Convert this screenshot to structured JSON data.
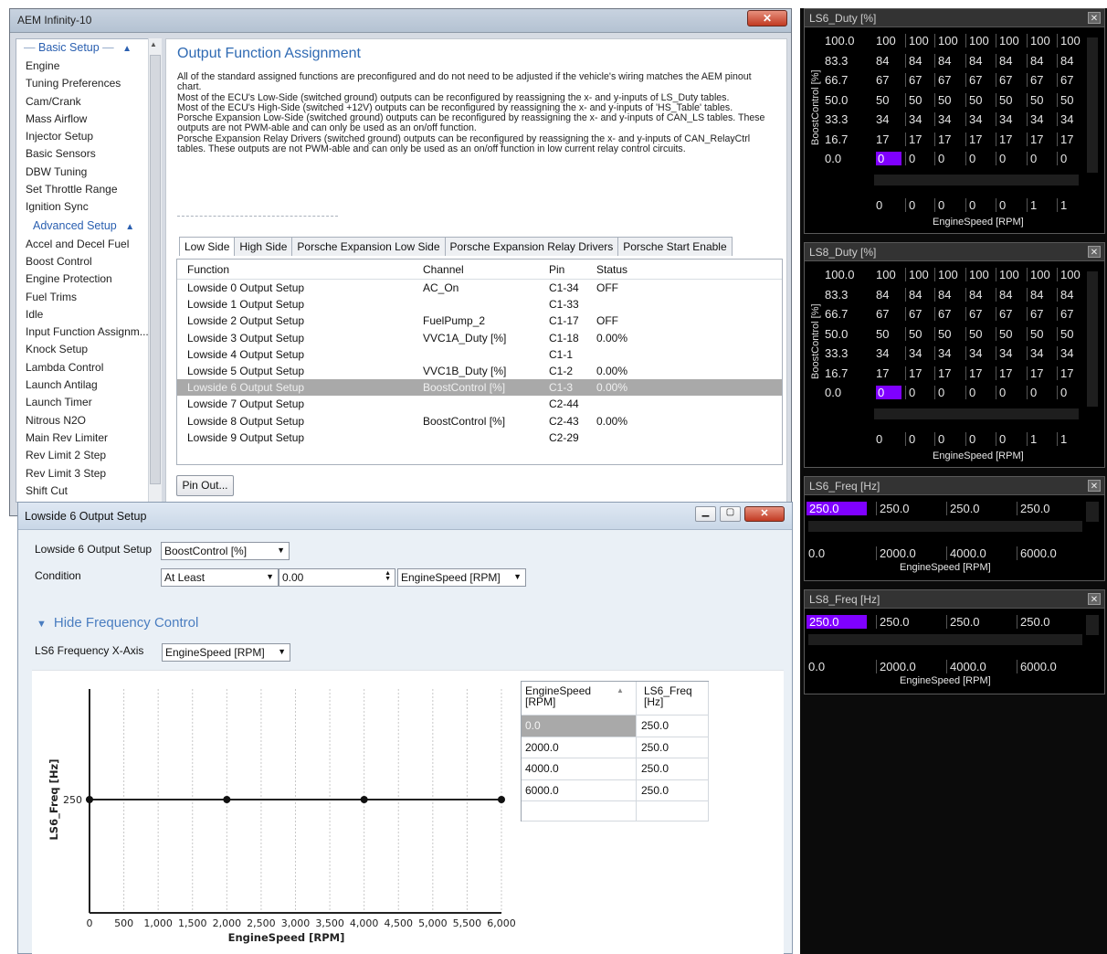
{
  "main_window": {
    "title": "AEM Infinity-10",
    "close_glyph": "✕"
  },
  "nav": {
    "basic_setup_header": "Basic Setup",
    "basic_items": [
      "Engine",
      "Tuning Preferences",
      "Cam/Crank",
      "Mass Airflow",
      "Injector Setup",
      "Basic Sensors",
      "DBW Tuning",
      "Set Throttle Range",
      "Ignition Sync"
    ],
    "advanced_setup_header": "Advanced Setup",
    "advanced_items": [
      "Accel and Decel Fuel",
      "Boost Control",
      "Engine Protection",
      "Fuel Trims",
      "Idle",
      "Input Function Assignm...",
      "Knock Setup",
      "Lambda Control",
      "Launch Antilag",
      "Launch Timer",
      "Nitrous N2O",
      "Main Rev Limiter",
      "Rev Limit 2 Step",
      "Rev Limit 3 Step",
      "Shift Cut"
    ]
  },
  "content": {
    "title": "Output Function Assignment",
    "paragraphs": [
      "All of the standard assigned functions are preconfigured and do not need to be adjusted if the vehicle's wiring matches the AEM pinout chart.",
      "Most of the ECU's Low-Side (switched ground) outputs can be reconfigured by reassigning the x- and y-inputs of LS_Duty tables.",
      "Most of the ECU's High-Side (switched +12V) outputs can be reconfigured by reassigning the x- and y-inputs of 'HS_Table' tables.",
      "Porsche Expansion Low-Side (switched ground) outputs can be reconfigured by reassigning the x- and y-inputs of CAN_LS tables. These outputs are not PWM-able and can only be used as an on/off function.",
      "Porsche Expansion Relay Drivers (switched ground) outputs can be reconfigured by reassigning the x- and y-inputs of CAN_RelayCtrl tables. These outputs are not PWM-able and can only be used as an on/off function in low current relay control circuits."
    ],
    "tabs": [
      "Low Side",
      "High Side",
      "Porsche Expansion Low Side",
      "Porsche Expansion Relay Drivers",
      "Porsche Start Enable"
    ],
    "table": {
      "headers": [
        "Function",
        "Channel",
        "Pin",
        "Status"
      ],
      "rows": [
        {
          "function": "Lowside 0 Output Setup",
          "channel": "AC_On",
          "pin": "C1-34",
          "status": "OFF"
        },
        {
          "function": "Lowside 1 Output Setup",
          "channel": "",
          "pin": "C1-33",
          "status": ""
        },
        {
          "function": "Lowside 2 Output Setup",
          "channel": "FuelPump_2",
          "pin": "C1-17",
          "status": "OFF"
        },
        {
          "function": "Lowside 3 Output Setup",
          "channel": "VVC1A_Duty [%]",
          "pin": "C1-18",
          "status": "0.00%"
        },
        {
          "function": "Lowside 4 Output Setup",
          "channel": "",
          "pin": "C1-1",
          "status": ""
        },
        {
          "function": "Lowside 5 Output Setup",
          "channel": "VVC1B_Duty [%]",
          "pin": "C1-2",
          "status": "0.00%"
        },
        {
          "function": "Lowside 6 Output Setup",
          "channel": "BoostControl [%]",
          "pin": "C1-3",
          "status": "0.00%"
        },
        {
          "function": "Lowside 7 Output Setup",
          "channel": "",
          "pin": "C2-44",
          "status": ""
        },
        {
          "function": "Lowside 8 Output Setup",
          "channel": "BoostControl [%]",
          "pin": "C2-43",
          "status": "0.00%"
        },
        {
          "function": "Lowside 9 Output Setup",
          "channel": "",
          "pin": "C2-29",
          "status": ""
        }
      ]
    },
    "pinout_button": "Pin Out..."
  },
  "sub_window": {
    "title": "Lowside 6 Output Setup",
    "setup_label": "Lowside 6 Output Setup",
    "setup_value": "BoostControl [%]",
    "condition_label": "Condition",
    "condition_value": "At Least",
    "condition_number": "0.00",
    "condition_channel": "EngineSpeed [RPM]",
    "freq_toggle": "Hide Frequency Control",
    "freq_xaxis_label": "LS6 Frequency X-Axis",
    "freq_xaxis_value": "EngineSpeed [RPM]",
    "freq_table": {
      "col1": "EngineSpeed [RPM]",
      "col2": "LS6_Freq [Hz]",
      "rows": [
        [
          "0.0",
          "250.0"
        ],
        [
          "2000.0",
          "250.0"
        ],
        [
          "4000.0",
          "250.0"
        ],
        [
          "6000.0",
          "250.0"
        ]
      ]
    }
  },
  "chart_data": {
    "type": "line",
    "x": [
      0,
      2000,
      4000,
      6000
    ],
    "y": [
      250,
      250,
      250,
      250
    ],
    "xlabel": "EngineSpeed [RPM]",
    "ylabel": "LS6_Freq [Hz]",
    "xlim": [
      0,
      6000
    ],
    "xticks": [
      "0",
      "500",
      "1,000",
      "1,500",
      "2,000",
      "2,500",
      "3,000",
      "3,500",
      "4,000",
      "4,500",
      "5,000",
      "5,500",
      "6,000"
    ],
    "yticks": [
      "250"
    ],
    "grid": "vertical"
  },
  "right_panel": {
    "ls6_duty": {
      "title": "LS6_Duty [%]",
      "ylabel": "BoostControl [%]",
      "rows": [
        [
          "100.0",
          "100",
          "100",
          "100",
          "100",
          "100",
          "100",
          "100"
        ],
        [
          "83.3",
          "84",
          "84",
          "84",
          "84",
          "84",
          "84",
          "84"
        ],
        [
          "66.7",
          "67",
          "67",
          "67",
          "67",
          "67",
          "67",
          "67"
        ],
        [
          "50.0",
          "50",
          "50",
          "50",
          "50",
          "50",
          "50",
          "50"
        ],
        [
          "33.3",
          "34",
          "34",
          "34",
          "34",
          "34",
          "34",
          "34"
        ],
        [
          "16.7",
          "17",
          "17",
          "17",
          "17",
          "17",
          "17",
          "17"
        ],
        [
          "0.0",
          "0",
          "0",
          "0",
          "0",
          "0",
          "0",
          "0"
        ]
      ],
      "x_axis": [
        "0",
        "0",
        "0",
        "0",
        "0",
        "1",
        "1"
      ],
      "xlabel": "EngineSpeed [RPM]"
    },
    "ls8_duty": {
      "title": "LS8_Duty [%]",
      "ylabel": "BoostControl [%]",
      "rows": [
        [
          "100.0",
          "100",
          "100",
          "100",
          "100",
          "100",
          "100",
          "100"
        ],
        [
          "83.3",
          "84",
          "84",
          "84",
          "84",
          "84",
          "84",
          "84"
        ],
        [
          "66.7",
          "67",
          "67",
          "67",
          "67",
          "67",
          "67",
          "67"
        ],
        [
          "50.0",
          "50",
          "50",
          "50",
          "50",
          "50",
          "50",
          "50"
        ],
        [
          "33.3",
          "34",
          "34",
          "34",
          "34",
          "34",
          "34",
          "34"
        ],
        [
          "16.7",
          "17",
          "17",
          "17",
          "17",
          "17",
          "17",
          "17"
        ],
        [
          "0.0",
          "0",
          "0",
          "0",
          "0",
          "0",
          "0",
          "0"
        ]
      ],
      "x_axis": [
        "0",
        "0",
        "0",
        "0",
        "0",
        "1",
        "1"
      ],
      "xlabel": "EngineSpeed [RPM]"
    },
    "ls6_freq": {
      "title": "LS6_Freq [Hz]",
      "values": [
        "250.0",
        "250.0",
        "250.0",
        "250.0"
      ],
      "x_axis": [
        "0.0",
        "2000.0",
        "4000.0",
        "6000.0"
      ],
      "xlabel": "EngineSpeed [RPM]"
    },
    "ls8_freq": {
      "title": "LS8_Freq [Hz]",
      "values": [
        "250.0",
        "250.0",
        "250.0",
        "250.0"
      ],
      "x_axis": [
        "0.0",
        "2000.0",
        "4000.0",
        "6000.0"
      ],
      "xlabel": "EngineSpeed [RPM]"
    },
    "highlight_color": "#7f00ff"
  }
}
